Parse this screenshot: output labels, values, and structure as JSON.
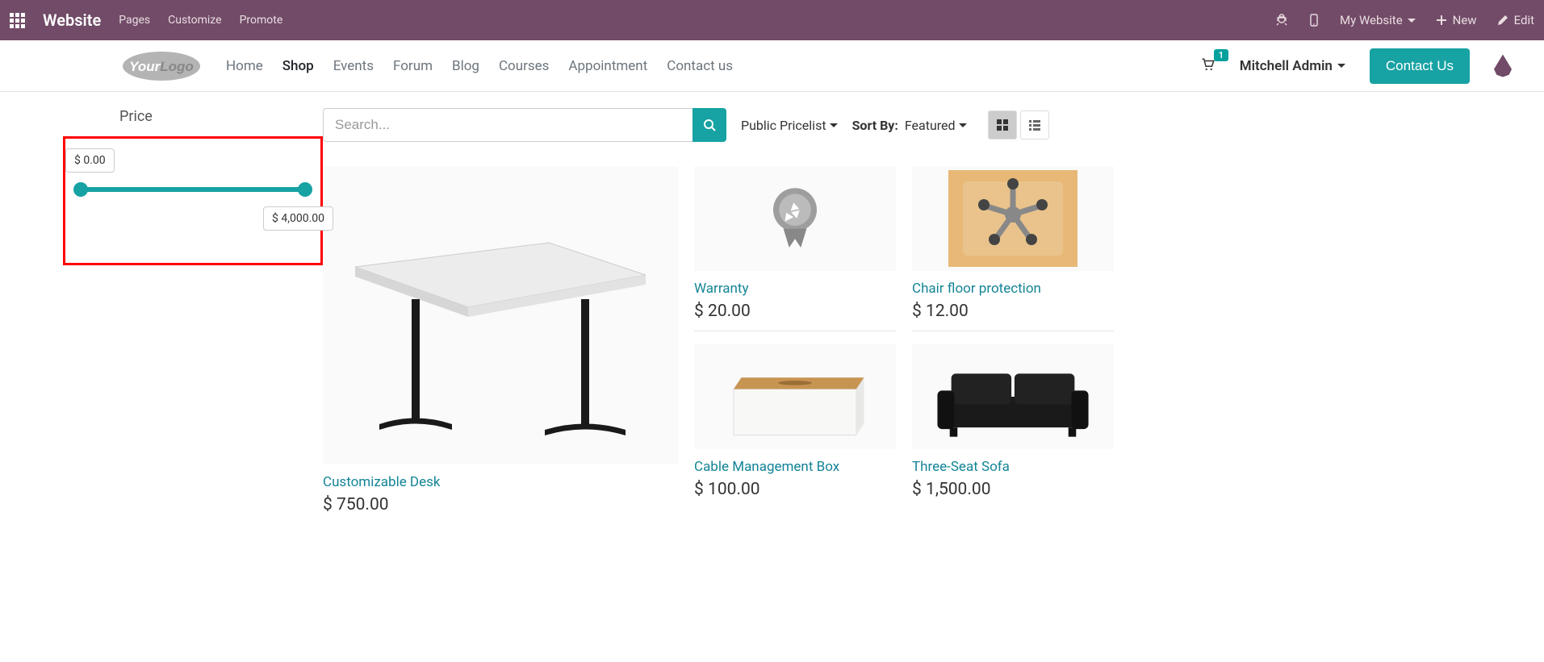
{
  "topbar": {
    "title": "Website",
    "menu": {
      "pages": "Pages",
      "customize": "Customize",
      "promote": "Promote"
    },
    "right": {
      "mywebsite": "My Website",
      "new": "New",
      "edit": "Edit"
    }
  },
  "nav": {
    "links": {
      "home": "Home",
      "shop": "Shop",
      "events": "Events",
      "forum": "Forum",
      "blog": "Blog",
      "courses": "Courses",
      "appointment": "Appointment",
      "contact": "Contact us"
    },
    "cart_count": "1",
    "user": "Mitchell Admin",
    "contact_btn": "Contact Us"
  },
  "filter": {
    "price_label": "Price",
    "min": "$ 0.00",
    "max": "$ 4,000.00"
  },
  "search": {
    "placeholder": "Search..."
  },
  "pricelist": "Public Pricelist",
  "sort": {
    "label": "Sort By:",
    "value": "Featured"
  },
  "products": {
    "feature": {
      "name": "Customizable Desk",
      "price": "$ 750.00"
    },
    "col1": [
      {
        "name": "Warranty",
        "price": "$ 20.00"
      },
      {
        "name": "Cable Management Box",
        "price": "$ 100.00"
      }
    ],
    "col2": [
      {
        "name": "Chair floor protection",
        "price": "$ 12.00"
      },
      {
        "name": "Three-Seat Sofa",
        "price": "$ 1,500.00"
      }
    ]
  }
}
